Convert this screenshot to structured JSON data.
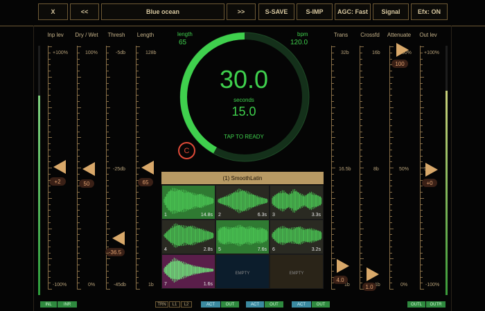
{
  "toolbar": {
    "close": "X",
    "prev": "<<",
    "title": "Blue ocean",
    "next": ">>",
    "ssave": "S-SAVE",
    "simp": "S-IMP",
    "agc": "AGC: Fast",
    "signal": "Signal",
    "efx": "Efx: ON"
  },
  "columns": {
    "inp_lev": {
      "label": "Inp lev",
      "top": "+100%",
      "bottom": "-100%",
      "value": "+2"
    },
    "dry_wet": {
      "label": "Dry / Wet",
      "top": "100%",
      "bottom": "0%",
      "value": "50"
    },
    "thresh": {
      "label": "Thresh",
      "top": "-5db",
      "mid": "-25db",
      "bottom": "-45db",
      "value": "-36.5"
    },
    "length": {
      "label": "Length",
      "top": "128b",
      "bottom": "1b",
      "value": "65"
    },
    "trans": {
      "label": "Trans",
      "top": "32b",
      "mid": "16.5b",
      "bottom": "1b",
      "value": "4.0"
    },
    "crossfd": {
      "label": "Crossfd",
      "top": "16b",
      "mid": "8b",
      "bottom": "1b",
      "value": "1.0"
    },
    "attenuate": {
      "label": "Attenuate",
      "top": "100%",
      "mid": "50%",
      "bottom": "0%",
      "value": "100"
    },
    "out_lev": {
      "label": "Out lev",
      "top": "+100%",
      "bottom": "-100%",
      "value": "+0"
    }
  },
  "dial": {
    "length_label": "length",
    "length_value": "65",
    "bpm_label": "bpm",
    "bpm_value": "120.0",
    "main_value": "30.0",
    "unit": "seconds",
    "sub_value": "15.0",
    "tap": "TAP TO READY",
    "progress": 0.42
  },
  "clear_button": "C",
  "pattern": {
    "title": "(1) SmoothLatin",
    "cells": [
      {
        "num": "1",
        "dur": "14.8s"
      },
      {
        "num": "2",
        "dur": "6.3s"
      },
      {
        "num": "3",
        "dur": "3.3s"
      },
      {
        "num": "4",
        "dur": "2.8s"
      },
      {
        "num": "5",
        "dur": "7.6s"
      },
      {
        "num": "6",
        "dur": "3.2s"
      },
      {
        "num": "7",
        "dur": "1.6s"
      },
      {
        "empty": "EMPTY"
      },
      {
        "empty": "EMPTY"
      }
    ]
  },
  "bottom": {
    "inl": "INL",
    "inr": "INR",
    "trn": "TRN",
    "l1": "L1",
    "l2": "L2",
    "act1": "ACT",
    "out1": "OUT",
    "act2": "ACT",
    "out2": "OUT",
    "act3": "ACT",
    "out3": "OUT",
    "outl": "OUTL",
    "outr": "OUTR"
  },
  "meters": {
    "inp": 0.8,
    "out": 0.82
  },
  "colors": {
    "accent": "#d8a86a",
    "green": "#3fd04d",
    "red": "#e04a38",
    "border": "#6f5a35"
  }
}
